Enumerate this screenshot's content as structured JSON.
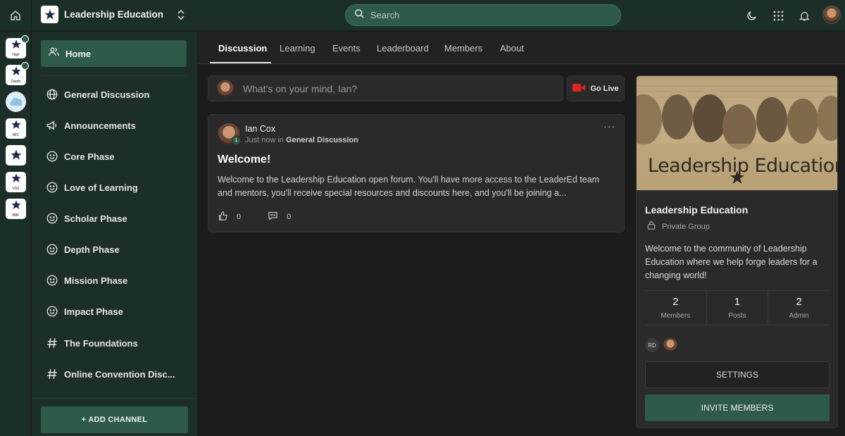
{
  "header": {
    "community_name": "Leadership Education",
    "search_placeholder": "Search"
  },
  "rail": {
    "items": [
      {
        "label": "High"
      },
      {
        "label": "Depth"
      },
      {
        "label": ""
      },
      {
        "label": "MIC"
      },
      {
        "label": ""
      },
      {
        "label": "VSS"
      },
      {
        "label": "BBF"
      }
    ]
  },
  "sidebar": {
    "home": "Home",
    "items": [
      {
        "label": "General Discussion",
        "icon": "globe-icon"
      },
      {
        "label": "Announcements",
        "icon": "megaphone-icon"
      },
      {
        "label": "Core Phase",
        "icon": "smile-icon"
      },
      {
        "label": "Love of Learning",
        "icon": "smile-icon"
      },
      {
        "label": "Scholar Phase",
        "icon": "smile-icon"
      },
      {
        "label": "Depth Phase",
        "icon": "smile-icon"
      },
      {
        "label": "Mission Phase",
        "icon": "smile-icon"
      },
      {
        "label": "Impact Phase",
        "icon": "smile-icon"
      },
      {
        "label": "The Foundations",
        "icon": "hash-icon"
      },
      {
        "label": "Online Convention Disc...",
        "icon": "hash-icon"
      }
    ],
    "add_channel": "+ ADD CHANNEL"
  },
  "tabs": [
    {
      "label": "Discussion",
      "active": true
    },
    {
      "label": "Learning"
    },
    {
      "label": "Events"
    },
    {
      "label": "Leaderboard"
    },
    {
      "label": "Members"
    },
    {
      "label": "About"
    }
  ],
  "composer": {
    "placeholder": "What's on your mind, Ian?",
    "go_live": "Go Live"
  },
  "post": {
    "author": "Ian Cox",
    "author_badge": "1",
    "time": "Just now",
    "in_word": "in",
    "channel": "General Discussion",
    "title": "Welcome!",
    "body": "Welcome to the Leadership Education open forum. You'll have more access to the LeaderEd team and mentors, you'll receive special resources and discounts here, and you'll be joining a...",
    "likes": "0",
    "comments": "0"
  },
  "group": {
    "banner_text": "Leadership Education",
    "name": "Leadership Education",
    "privacy": "Private Group",
    "description": "Welcome to the community of Leadership Education where we help forge leaders for a changing world!",
    "stats": [
      {
        "value": "2",
        "label": "Members"
      },
      {
        "value": "1",
        "label": "Posts"
      },
      {
        "value": "2",
        "label": "Admin"
      }
    ],
    "member_initials": "RD",
    "settings_label": "SETTINGS",
    "invite_label": "INVITE MEMBERS"
  },
  "colors": {
    "accent": "#2d5a49",
    "topbar": "#1c2e28",
    "background": "#1b1b1b",
    "card": "#2a2a2a",
    "live_red": "#e02424"
  }
}
